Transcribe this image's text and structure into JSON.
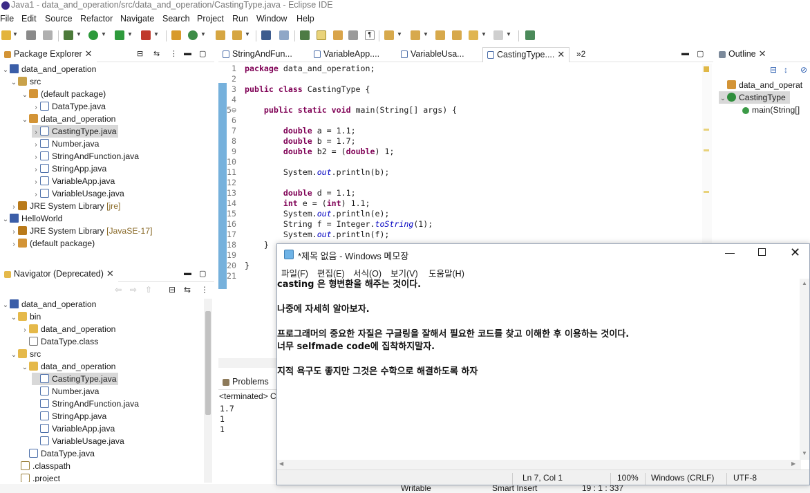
{
  "window": {
    "title": "Java1 - data_and_operation/src/data_and_operation/CastingType.java - Eclipse IDE"
  },
  "menu": [
    "File",
    "Edit",
    "Source",
    "Refactor",
    "Navigate",
    "Search",
    "Project",
    "Run",
    "Window",
    "Help"
  ],
  "package_explorer": {
    "tab": "Package Explorer",
    "rows": [
      {
        "label": "data_and_operation",
        "suffix": ""
      },
      {
        "label": "src",
        "suffix": ""
      },
      {
        "label": "(default package)",
        "suffix": ""
      },
      {
        "label": "DataType.java",
        "suffix": ""
      },
      {
        "label": "data_and_operation",
        "suffix": ""
      },
      {
        "label": "CastingType.java",
        "suffix": ""
      },
      {
        "label": "Number.java",
        "suffix": ""
      },
      {
        "label": "StringAndFunction.java",
        "suffix": ""
      },
      {
        "label": "StringApp.java",
        "suffix": ""
      },
      {
        "label": "VariableApp.java",
        "suffix": ""
      },
      {
        "label": "VariableUsage.java",
        "suffix": ""
      },
      {
        "label": "JRE System Library",
        "suffix": "[jre]"
      },
      {
        "label": "HelloWorld",
        "suffix": ""
      },
      {
        "label": "JRE System Library",
        "suffix": "[JavaSE-17]"
      },
      {
        "label": "(default package)",
        "suffix": ""
      }
    ]
  },
  "navigator": {
    "tab": "Navigator (Deprecated)",
    "rows": [
      "data_and_operation",
      "bin",
      "data_and_operation",
      "DataType.class",
      "src",
      "data_and_operation",
      "CastingType.java",
      "Number.java",
      "StringAndFunction.java",
      "StringApp.java",
      "VariableApp.java",
      "VariableUsage.java",
      "DataType.java",
      ".classpath",
      ".project"
    ]
  },
  "editor": {
    "tabs": [
      "StringAndFun...",
      "VariableApp....",
      "VariableUsa...",
      "CastingType....",
      "»2"
    ],
    "active_tab": "CastingType....",
    "lines": [
      {
        "n": "1",
        "t": "package data_and_operation;"
      },
      {
        "n": "2",
        "t": ""
      },
      {
        "n": "3",
        "t": "public class CastingType {"
      },
      {
        "n": "4",
        "t": ""
      },
      {
        "n": "5⊖",
        "t": "    public static void main(String[] args) {"
      },
      {
        "n": "6",
        "t": ""
      },
      {
        "n": "7",
        "t": "        double a = 1.1;"
      },
      {
        "n": "8",
        "t": "        double b = 1.7;"
      },
      {
        "n": "9",
        "t": "        double b2 = (double) 1;"
      },
      {
        "n": "10",
        "t": ""
      },
      {
        "n": "11",
        "t": "        System.out.println(b);"
      },
      {
        "n": "12",
        "t": ""
      },
      {
        "n": "13",
        "t": "        double d = 1.1;"
      },
      {
        "n": "14",
        "t": "        int e = (int) 1.1;"
      },
      {
        "n": "15",
        "t": "        System.out.println(e);"
      },
      {
        "n": "16",
        "t": "        String f = Integer.toString(1);"
      },
      {
        "n": "17",
        "t": "        System.out.println(f);"
      },
      {
        "n": "18",
        "t": "    }"
      },
      {
        "n": "19",
        "t": ""
      },
      {
        "n": "20",
        "t": "}"
      },
      {
        "n": "21",
        "t": ""
      }
    ]
  },
  "outline": {
    "tab": "Outline",
    "rows": [
      "data_and_operat",
      "CastingType",
      "main(String[]"
    ]
  },
  "console": {
    "tab": "Problems",
    "header": "<terminated> C",
    "output": [
      "1.7",
      "1",
      "1"
    ]
  },
  "notepad": {
    "title": "*제목 없음 - Windows 메모장",
    "menu": [
      "파일(F)",
      "편집(E)",
      "서식(O)",
      "보기(V)",
      "도움말(H)"
    ],
    "lines": [
      "casting 은 형변환을 해주는 것이다.",
      "",
      "나중에 자세히 알아보자.",
      "",
      "프로그래머의 중요한 자질은 구글링을 잘해서 필요한 코드를 찾고 이해한 후 이용하는 것이다.",
      "너무 selfmade code에 집착하지말자.",
      "",
      "지적 욕구도 좋지만 그것은 수학으로 해결하도록 하자"
    ],
    "status": {
      "position": "Ln 7, Col 1",
      "zoom": "100%",
      "line_ending": "Windows (CRLF)",
      "encoding": "UTF-8"
    }
  },
  "eclipse_status": {
    "mode": "Writable",
    "insert": "Smart Insert",
    "position": "19 : 1 : 337"
  }
}
